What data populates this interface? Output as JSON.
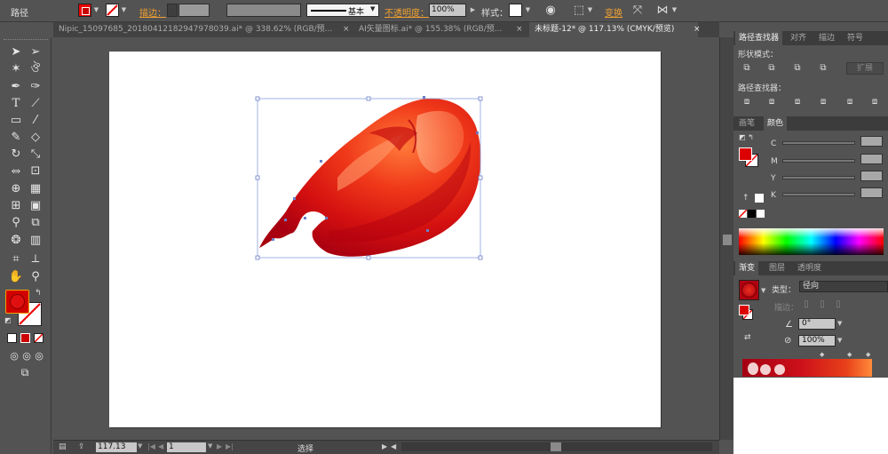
{
  "control_bar": {
    "object_type": "路径",
    "stroke_label": "描边：",
    "stroke_line_label": "基本",
    "opacity_label": "不透明度：",
    "opacity_value": "100%",
    "style_label": "样式：",
    "transform_label": "变换"
  },
  "tabs": [
    {
      "label": "Nipic_15097685_20180412182947978039.ai* @ 338.62% (RGB/预...",
      "close": "×"
    },
    {
      "label": "AI矢量图标.ai* @ 155.38% (RGB/预...",
      "close": "×"
    },
    {
      "label": "未标题-12* @ 117.13% (CMYK/预览)",
      "close": "×"
    }
  ],
  "toolbar": {
    "tools": [
      "selection-tool",
      "direct-selection-tool",
      "magic-wand-tool",
      "lasso-tool",
      "pen-tool",
      "curvature-tool",
      "type-tool",
      "line-tool",
      "rectangle-tool",
      "paintbrush-tool",
      "pencil-tool",
      "eraser-tool",
      "rotate-tool",
      "scale-tool",
      "width-tool",
      "free-transform-tool",
      "shape-builder-tool",
      "perspective-grid-tool",
      "mesh-tool",
      "gradient-tool",
      "eyedropper-tool",
      "blend-tool",
      "symbol-sprayer-tool",
      "column-graph-tool",
      "artboard-tool",
      "slice-tool",
      "hand-tool",
      "zoom-tool"
    ]
  },
  "status": {
    "zoom": "117.13",
    "page": "1",
    "mode": "选择"
  },
  "pathfinder_panel": {
    "tabs": [
      "路径查找器",
      "对齐",
      "描边",
      "符号"
    ],
    "shape_modes_label": "形状模式：",
    "expand_label": "扩展",
    "pathfinders_label": "路径查找器："
  },
  "color_panel": {
    "tabs": [
      "画笔",
      "颜色"
    ],
    "channels": [
      "C",
      "M",
      "Y",
      "K"
    ]
  },
  "gradient_panel": {
    "tabs": [
      "渐变",
      "图层",
      "透明度"
    ],
    "type_label": "类型：",
    "type_value": "径向",
    "stroke_label": "描边：",
    "angle_value": "0°",
    "ratio_value": "100%"
  },
  "colors": {
    "fill": "#cc0000",
    "accent_orange": "#f0a030",
    "gradient_start": "#a40012",
    "gradient_end": "#ff8a3a"
  }
}
